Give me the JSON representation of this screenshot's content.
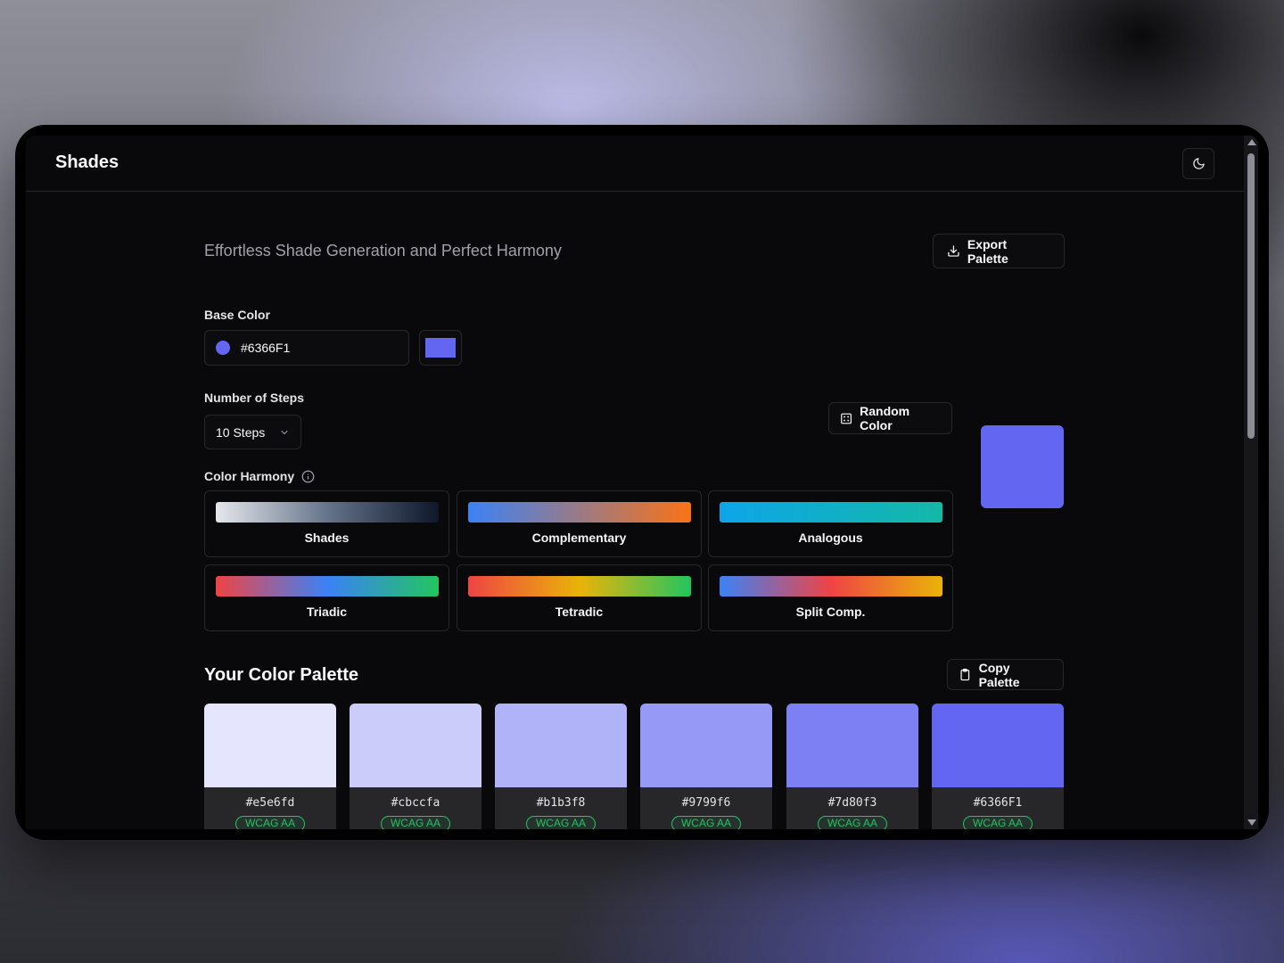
{
  "app": {
    "title": "Shades"
  },
  "header": {
    "tagline": "Effortless Shade Generation and Perfect Harmony",
    "export_label": "Export Palette"
  },
  "base_color": {
    "label": "Base Color",
    "value": "#6366F1",
    "color": "#6366F1"
  },
  "steps": {
    "label": "Number of Steps",
    "value": "10 Steps"
  },
  "random": {
    "label": "Random Color"
  },
  "harmony": {
    "label": "Color Harmony",
    "options": [
      {
        "name": "Shades",
        "gradient": "linear-gradient(90deg,#e5e7eb,#64748b 50%,#0f172a)"
      },
      {
        "name": "Complementary",
        "gradient": "linear-gradient(90deg,#3b82f6,#f97316)"
      },
      {
        "name": "Analogous",
        "gradient": "linear-gradient(90deg,#0ea5e9,#14b8a6)"
      },
      {
        "name": "Triadic",
        "gradient": "linear-gradient(90deg,#ef4444,#3b82f6 50%,#22c55e)"
      },
      {
        "name": "Tetradic",
        "gradient": "linear-gradient(90deg,#ef4444,#eab308 50%,#22c55e)"
      },
      {
        "name": "Split Comp.",
        "gradient": "linear-gradient(90deg,#3b82f6,#ef4444 50%,#eab308)"
      }
    ]
  },
  "palette": {
    "title": "Your Color Palette",
    "copy_label": "Copy Palette",
    "swatches": [
      {
        "hex": "#e5e6fd",
        "badge": "WCAG AA"
      },
      {
        "hex": "#cbccfa",
        "badge": "WCAG AA"
      },
      {
        "hex": "#b1b3f8",
        "badge": "WCAG AA"
      },
      {
        "hex": "#9799f6",
        "badge": "WCAG AA"
      },
      {
        "hex": "#7d80f3",
        "badge": "WCAG AA"
      },
      {
        "hex": "#6366F1",
        "badge": "WCAG AA"
      }
    ]
  }
}
